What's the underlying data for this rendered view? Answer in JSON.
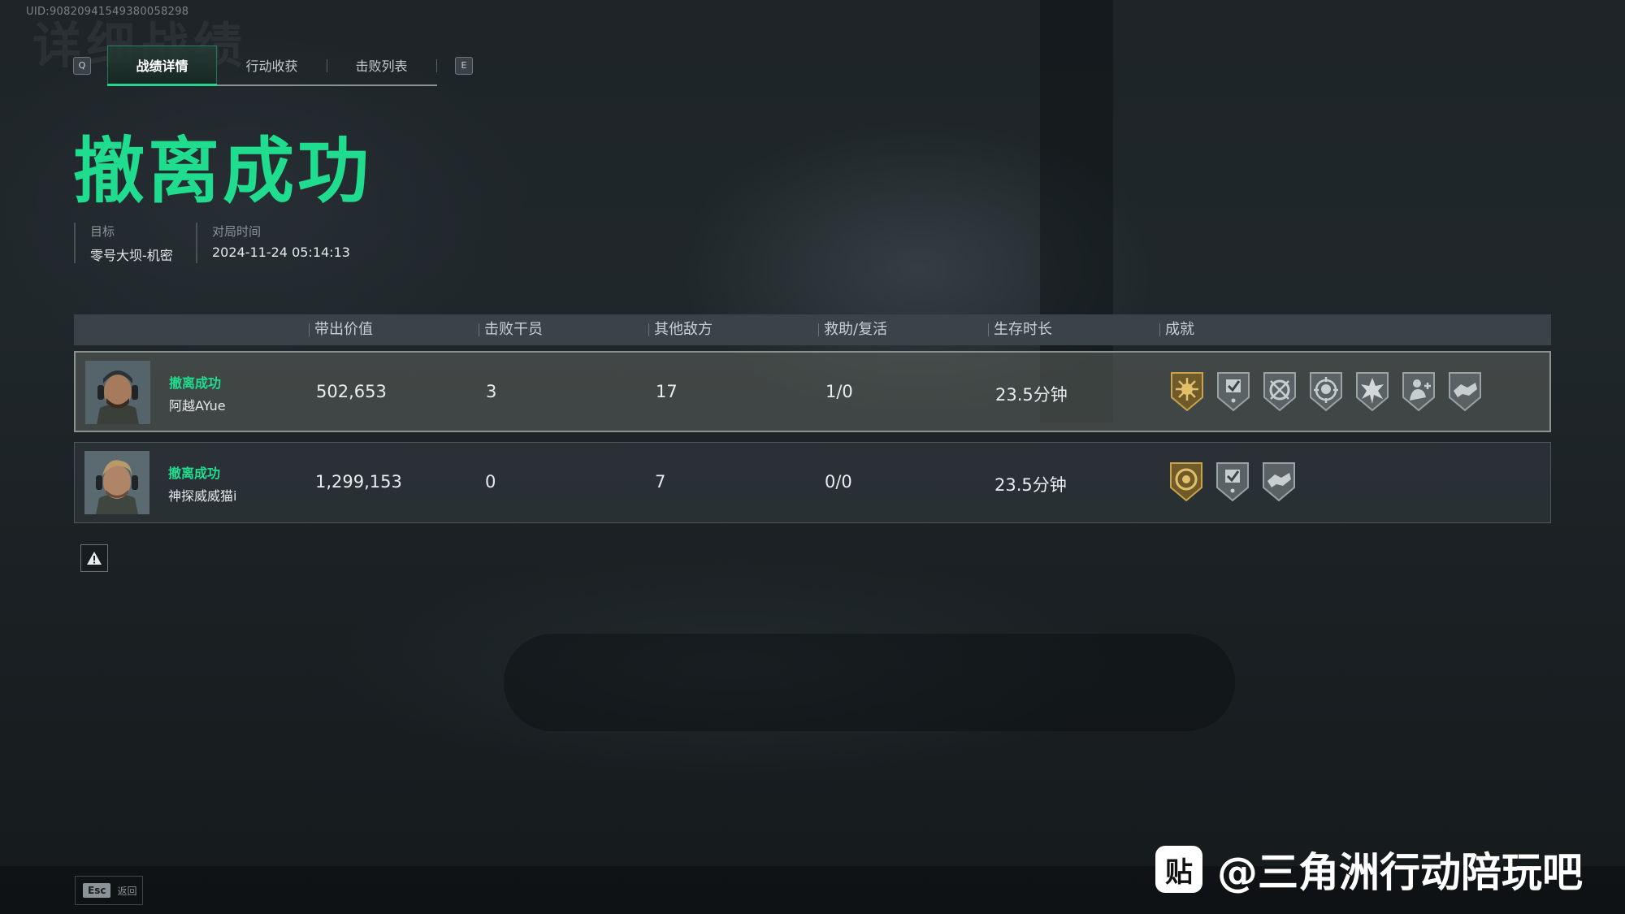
{
  "uid": "UID:9082094154938005829​8",
  "ghost_title": "详细战绩",
  "tabs": {
    "prev_key": "Q",
    "next_key": "E",
    "items": [
      {
        "label": "战绩详情",
        "active": true
      },
      {
        "label": "行动收获",
        "active": false
      },
      {
        "label": "击败列表",
        "active": false
      }
    ]
  },
  "result_title": "撤离成功",
  "meta": {
    "target_label": "目标",
    "target_value": "零号大坝-机密",
    "time_label": "对局时间",
    "time_value": "2024-11-24 05:14:13"
  },
  "table": {
    "headers": [
      "带出价值",
      "击败干员",
      "其他敌方",
      "救助/复活",
      "生存时长",
      "成就"
    ],
    "rows": [
      {
        "status": "撤离成功",
        "name": "阿越AYue",
        "value": "502,653",
        "kills": "3",
        "other": "17",
        "assist": "1/0",
        "survival": "23.5分钟",
        "badges": [
          "sun-medal-icon",
          "checkmark-shield-icon",
          "crosshair-badge-icon",
          "target-skull-badge-icon",
          "burst-star-badge-icon",
          "medic-badge-icon",
          "handshake-badge-icon"
        ]
      },
      {
        "status": "撤离成功",
        "name": "神探威威猫i",
        "value": "1,299,153",
        "kills": "0",
        "other": "7",
        "assist": "0/0",
        "survival": "23.5分钟",
        "badges": [
          "gold-coin-medal-icon",
          "checkmark-shield-icon",
          "handshake-badge-icon"
        ]
      }
    ]
  },
  "footer": {
    "esc_key": "Esc",
    "esc_label": "返回"
  },
  "watermark": {
    "logo_text": "贴",
    "text": "@三角洲行动陪玩吧"
  },
  "colors": {
    "accent": "#1fdc8f",
    "gold_badge": "#c9a24a",
    "gray_badge": "#9aa2a6"
  }
}
